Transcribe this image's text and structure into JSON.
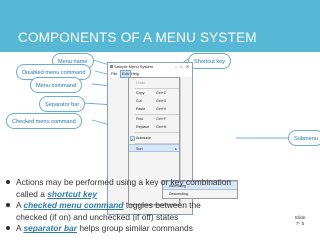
{
  "slide": {
    "title": "COMPONENTS OF A MENU SYSTEM",
    "slide_number_label": "Slide",
    "slide_number": "7- 5"
  },
  "window": {
    "title": "Sample Menu System",
    "menubar": [
      "File",
      "Edit",
      "Help"
    ],
    "active_menu": "Edit"
  },
  "menu": {
    "undo": "Undo",
    "copy": "Copy",
    "copy_shortcut": "Ctrl+C",
    "cut": "Cut",
    "cut_shortcut": "Ctrl+X",
    "paste": "Paste",
    "paste_shortcut": "Ctrl+V",
    "find": "Find",
    "find_shortcut": "Ctrl+F",
    "replace": "Replace",
    "replace_shortcut": "Ctrl+H",
    "autosave": "Autosave",
    "autosave_checked": true,
    "sort": "Sort",
    "checkmark": "✓",
    "submenu_arrow": "▸"
  },
  "submenu": {
    "items": [
      "Ascending",
      "Descending"
    ]
  },
  "callouts": {
    "menu_name": "Menu name",
    "disabled_menu_command": "Disabled menu command",
    "menu_command": "Menu command",
    "separator_bar": "Separator bar",
    "checked_menu_command": "Checked menu command",
    "shortcut_key": "Shortcut key",
    "submenu": "Submenu"
  },
  "colors": {
    "title_band": "#56b8d4",
    "callout_text": "#1f78b4",
    "term": "#2e7da6",
    "body_text": "#333333"
  },
  "bullets": [
    {
      "text_before": "Actions may be performed using a key or key combination",
      "text_cont": "called a",
      "term": "shortcut key"
    },
    {
      "text_before": "A",
      "term": "checked menu command",
      "text_after": "toggles between the",
      "text_cont": "checked (if on) and unchecked (if off) states"
    },
    {
      "text_before": "A",
      "term": "separator bar",
      "text_after": "helps group similar commands"
    }
  ]
}
